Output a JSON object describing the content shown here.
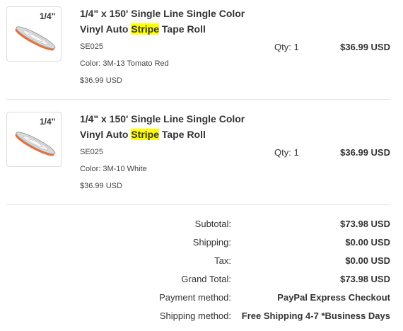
{
  "items": [
    {
      "thumb_label": "1/4\"",
      "title_before": "1/4\" x 150' Single Line Single Color Vinyl Auto ",
      "title_highlight": "Stripe",
      "title_after": " Tape Roll",
      "sku": "SE025",
      "color": "Color: 3M-13 Tomato Red",
      "unit_price": "$36.99 USD",
      "qty": "Qty: 1",
      "price": "$36.99 USD"
    },
    {
      "thumb_label": "1/4\"",
      "title_before": "1/4\" x 150' Single Line Single Color Vinyl Auto ",
      "title_highlight": "Stripe",
      "title_after": " Tape Roll",
      "sku": "SE025",
      "color": "Color: 3M-10 White",
      "unit_price": "$36.99 USD",
      "qty": "Qty: 1",
      "price": "$36.99 USD"
    }
  ],
  "totals": [
    {
      "label": "Subtotal:",
      "value": "$73.98 USD"
    },
    {
      "label": "Shipping:",
      "value": "$0.00 USD"
    },
    {
      "label": "Tax:",
      "value": "$0.00 USD"
    },
    {
      "label": "Grand Total:",
      "value": "$73.98 USD"
    },
    {
      "label": "Payment method:",
      "value": "PayPal Express Checkout"
    },
    {
      "label": "Shipping method:",
      "value": "Free Shipping 4-7 *Business Days"
    }
  ],
  "colors": {
    "highlight": "#ffff00",
    "tape_orange": "#f26b2a",
    "separator": "#e3e3e3"
  }
}
